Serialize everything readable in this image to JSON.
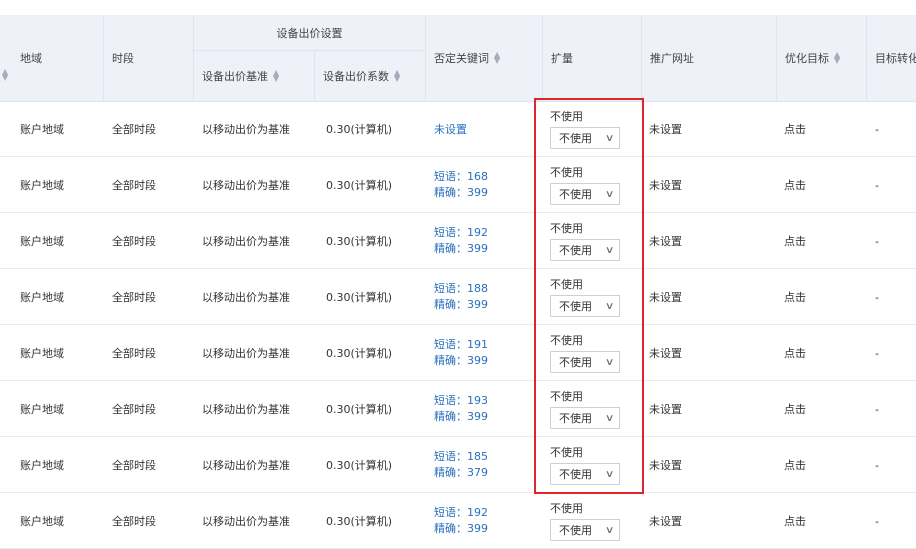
{
  "header": {
    "region": "地域",
    "time_period": "时段",
    "device_bid_group": "设备出价设置",
    "device_bid_base": "设备出价基准",
    "device_bid_coef": "设备出价系数",
    "negative_keywords": "否定关键词",
    "expand": "扩量",
    "promo_url": "推广网址",
    "opt_target": "优化目标",
    "target_conv": "目标转化"
  },
  "rows": [
    {
      "region": "账户地域",
      "time": "全部时段",
      "base": "以移动出价为基准",
      "coef": "0.30(计算机)",
      "kw_single": "未设置",
      "kw_phrase": "",
      "kw_exact": "",
      "expand_value": "不使用",
      "expand_select": "不使用",
      "url": "未设置",
      "target": "点击",
      "conv": "-"
    },
    {
      "region": "账户地域",
      "time": "全部时段",
      "base": "以移动出价为基准",
      "coef": "0.30(计算机)",
      "kw_single": "",
      "kw_phrase": "短语：168",
      "kw_exact": "精确：399",
      "expand_value": "不使用",
      "expand_select": "不使用",
      "url": "未设置",
      "target": "点击",
      "conv": "-"
    },
    {
      "region": "账户地域",
      "time": "全部时段",
      "base": "以移动出价为基准",
      "coef": "0.30(计算机)",
      "kw_single": "",
      "kw_phrase": "短语：192",
      "kw_exact": "精确：399",
      "expand_value": "不使用",
      "expand_select": "不使用",
      "url": "未设置",
      "target": "点击",
      "conv": "-"
    },
    {
      "region": "账户地域",
      "time": "全部时段",
      "base": "以移动出价为基准",
      "coef": "0.30(计算机)",
      "kw_single": "",
      "kw_phrase": "短语：188",
      "kw_exact": "精确：399",
      "expand_value": "不使用",
      "expand_select": "不使用",
      "url": "未设置",
      "target": "点击",
      "conv": "-"
    },
    {
      "region": "账户地域",
      "time": "全部时段",
      "base": "以移动出价为基准",
      "coef": "0.30(计算机)",
      "kw_single": "",
      "kw_phrase": "短语：191",
      "kw_exact": "精确：399",
      "expand_value": "不使用",
      "expand_select": "不使用",
      "url": "未设置",
      "target": "点击",
      "conv": "-"
    },
    {
      "region": "账户地域",
      "time": "全部时段",
      "base": "以移动出价为基准",
      "coef": "0.30(计算机)",
      "kw_single": "",
      "kw_phrase": "短语：193",
      "kw_exact": "精确：399",
      "expand_value": "不使用",
      "expand_select": "不使用",
      "url": "未设置",
      "target": "点击",
      "conv": "-"
    },
    {
      "region": "账户地域",
      "time": "全部时段",
      "base": "以移动出价为基准",
      "coef": "0.30(计算机)",
      "kw_single": "",
      "kw_phrase": "短语：185",
      "kw_exact": "精确：379",
      "expand_value": "不使用",
      "expand_select": "不使用",
      "url": "未设置",
      "target": "点击",
      "conv": "-"
    },
    {
      "region": "账户地域",
      "time": "全部时段",
      "base": "以移动出价为基准",
      "coef": "0.30(计算机)",
      "kw_single": "",
      "kw_phrase": "短语：192",
      "kw_exact": "精确：399",
      "expand_value": "不使用",
      "expand_select": "不使用",
      "url": "未设置",
      "target": "点击",
      "conv": "-"
    }
  ],
  "colors": {
    "header_bg": "#eef1f8",
    "link_blue": "#2a6fbf",
    "highlight_red": "#e0242b"
  },
  "icons": {
    "sort": "sort-icon",
    "dropdown": "chevron-down-icon"
  }
}
